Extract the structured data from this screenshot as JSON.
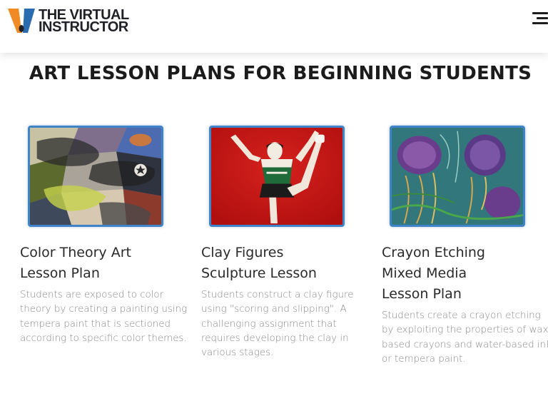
{
  "header": {
    "logo_line1": "THE VIRTUAL",
    "logo_line2": "INSTRUCTOR",
    "menu_icon": "hamburger-menu-icon"
  },
  "page": {
    "title": "ART LESSON PLANS FOR BEGINNING STUDENTS"
  },
  "cards": [
    {
      "title_line1": "Color Theory Art",
      "title_line2": "Lesson Plan",
      "title_line3": "",
      "description": "Students are exposed to color theory by creating a painting using tempera paint that is sectioned according to specific color themes.",
      "image": "sneakers-painting-image"
    },
    {
      "title_line1": "Clay Figures",
      "title_line2": "Sculpture Lesson",
      "title_line3": "",
      "description": "Students construct a clay figure using \"scoring and slipping\".  A challenging assignment that requires developing the clay in various stages.",
      "image": "clay-cheerleader-image"
    },
    {
      "title_line1": "Crayon Etching",
      "title_line2": "Mixed Media",
      "title_line3": "Lesson Plan",
      "description": "Students create a crayon etching by exploiting the properties of wax-based crayons and water-based ink or tempera paint.",
      "image": "jellyfish-etching-image"
    }
  ],
  "colors": {
    "card_border": "#3f84c8",
    "logo_orange": "#f08a24",
    "logo_blue": "#2b6cb0"
  }
}
